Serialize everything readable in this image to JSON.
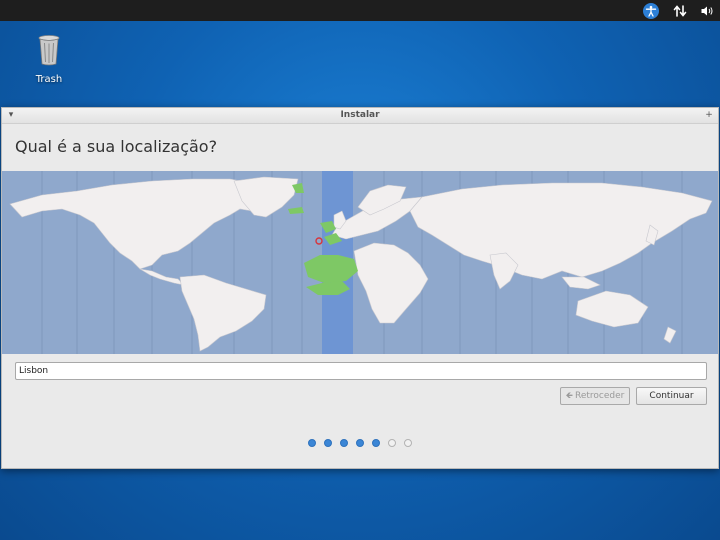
{
  "desktop": {
    "trash_label": "Trash"
  },
  "panel": {
    "tray_icons": [
      "accessibility-icon",
      "network-icon",
      "volume-icon"
    ]
  },
  "window": {
    "title": "Instalar",
    "heading": "Qual é a sua localização?",
    "location_value": "Lisbon",
    "back_label": "Retroceder",
    "continue_label": "Continuar",
    "progress": {
      "total": 7,
      "completed": 5
    }
  },
  "colors": {
    "ocean": "#8fa8cc",
    "land": "#f2efef",
    "timezone_highlight": "#6e95d3",
    "selected_region": "#7ec865",
    "accent": "#3b86d6"
  }
}
